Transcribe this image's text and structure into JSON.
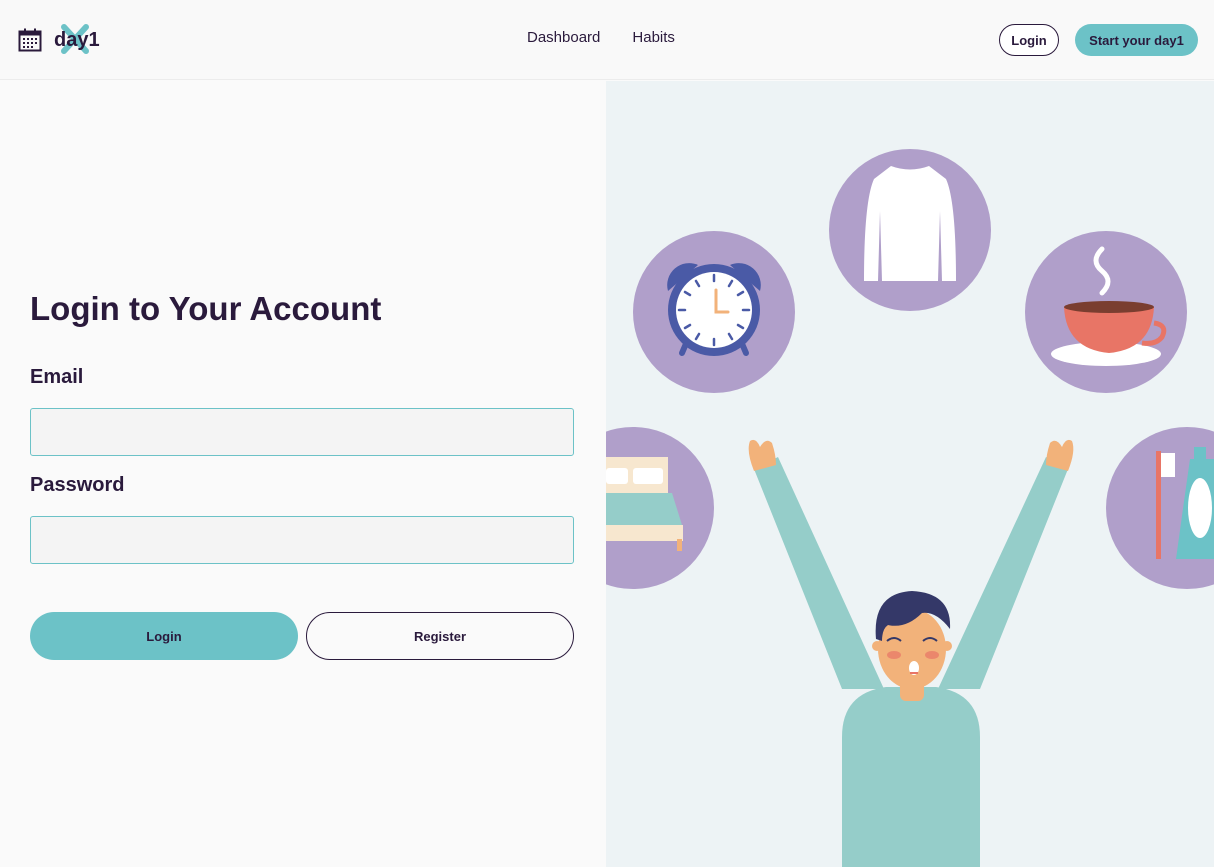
{
  "brand": {
    "name": "day1"
  },
  "nav": {
    "links": [
      "Dashboard",
      "Habits"
    ],
    "login_label": "Login",
    "start_label": "Start your day1"
  },
  "form": {
    "title": "Login to Your Account",
    "email_label": "Email",
    "email_value": "",
    "password_label": "Password",
    "password_value": "",
    "login_button": "Login",
    "register_button": "Register"
  },
  "illustration": {
    "icons": [
      "alarm-clock-icon",
      "sweater-icon",
      "coffee-cup-icon",
      "bed-icon",
      "toothbrush-toothpaste-icon"
    ],
    "figure": "person-stretching-arms-up"
  },
  "colors": {
    "accent": "#6cc2c7",
    "text": "#2a1a3c",
    "circle": "#b09fca",
    "skin": "#f2b27a",
    "shirt": "#95cdc9"
  }
}
